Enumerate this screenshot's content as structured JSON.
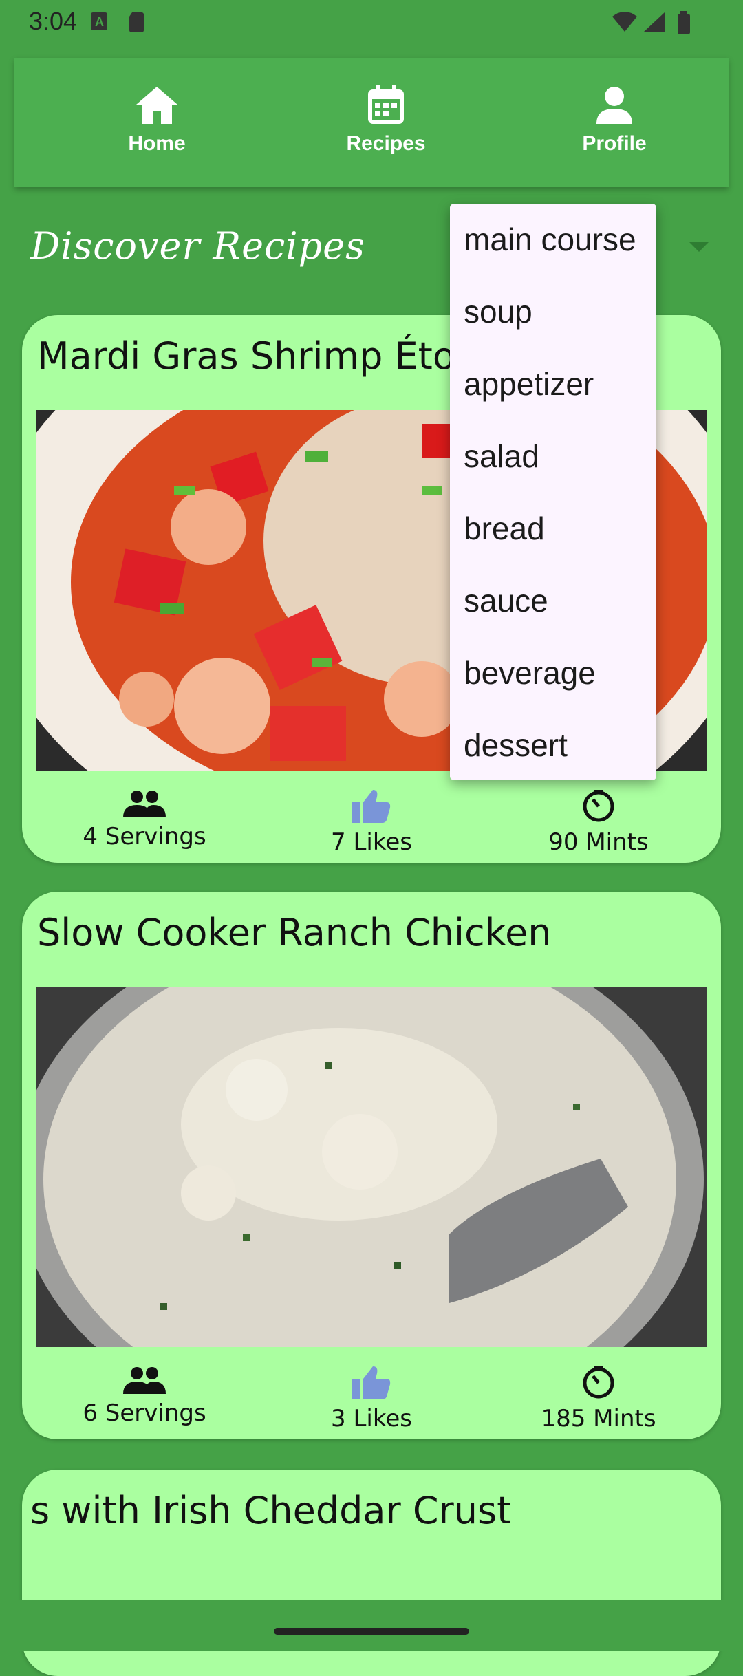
{
  "status_bar": {
    "time": "3:04"
  },
  "nav": {
    "items": [
      {
        "label": "Home",
        "icon": "home-icon"
      },
      {
        "label": "Recipes",
        "icon": "calendar-icon"
      },
      {
        "label": "Profile",
        "icon": "person-icon"
      }
    ]
  },
  "header": {
    "title": "Discover Recipes"
  },
  "category_menu": {
    "options": [
      "main course",
      "soup",
      "appetizer",
      "salad",
      "bread",
      "sauce",
      "beverage",
      "dessert"
    ]
  },
  "recipes": [
    {
      "title": "Mardi Gras Shrimp Étouffée",
      "servings": "4 Servings",
      "likes": "7 Likes",
      "time": "90 Mints"
    },
    {
      "title": "Slow Cooker Ranch Chicken",
      "servings": "6 Servings",
      "likes": "3 Likes",
      "time": "185 Mints"
    },
    {
      "title": "s with Irish Cheddar Crust"
    }
  ],
  "colors": {
    "background": "#45a247",
    "nav": "#4caf50",
    "card": "#aaffa0",
    "like_icon": "#7a95d8",
    "menu_bg": "#fcf4ff"
  }
}
